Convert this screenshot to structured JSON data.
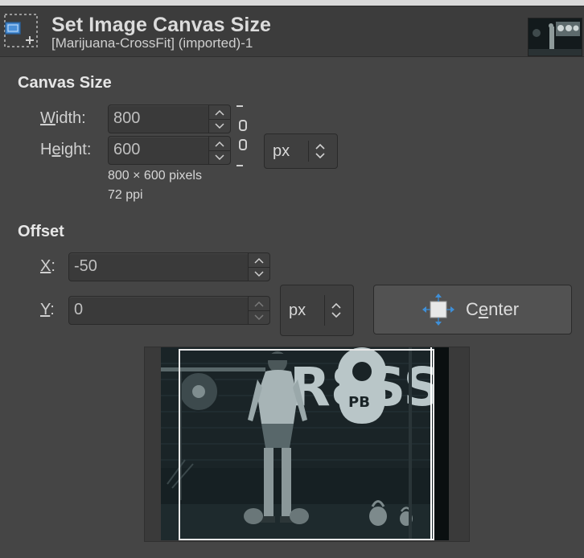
{
  "header": {
    "title": "Set Image Canvas Size",
    "subtitle": "[Marijuana-CrossFit] (imported)-1"
  },
  "canvas_size": {
    "section_title": "Canvas Size",
    "width_label_pre": "",
    "width_label_u": "W",
    "width_label_post": "idth:",
    "width_value": "800",
    "height_label_pre": "H",
    "height_label_u": "e",
    "height_label_post": "ight:",
    "height_value": "600",
    "unit": "px",
    "pixels_text": "800 × 600 pixels",
    "ppi_text": "72 ppi"
  },
  "offset": {
    "section_title": "Offset",
    "x_label_u": "X",
    "x_label_post": ":",
    "x_value": "-50",
    "y_label_u": "Y",
    "y_label_post": ":",
    "y_value": "0",
    "unit": "px",
    "center_label_pre": "C",
    "center_label_u": "e",
    "center_label_post": "nter"
  },
  "preview": {
    "wall_text": "R8SS",
    "plate_text": "PB"
  },
  "colors": {
    "background": "#454545",
    "header": "#3c3c3c",
    "accent_blue": "#3e8fd8"
  }
}
